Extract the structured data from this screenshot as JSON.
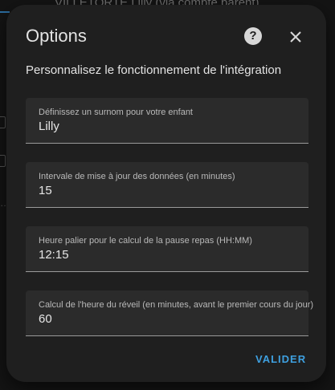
{
  "background": {
    "title": "VILLETORTE Lilly (via compte parent)"
  },
  "dialog": {
    "title": "Options",
    "subtitle": "Personnalisez le fonctionnement de l'intégration",
    "help_icon": "help-circle-icon",
    "close_icon": "close-icon",
    "fields": [
      {
        "label": "Définissez un surnom pour votre enfant",
        "value": "Lilly"
      },
      {
        "label": "Intervale de mise à jour des données (en minutes)",
        "value": "15"
      },
      {
        "label": "Heure palier pour le calcul de la pause repas (HH:MM)",
        "value": "12:15"
      },
      {
        "label": "Calcul de l'heure du réveil (en minutes, avant le premier cours du jour)",
        "value": "60"
      }
    ],
    "submit_label": "VALIDER"
  },
  "colors": {
    "dialog_bg": "#1f1f1f",
    "field_bg": "#2b2b2b",
    "accent": "#3ea0e0"
  }
}
